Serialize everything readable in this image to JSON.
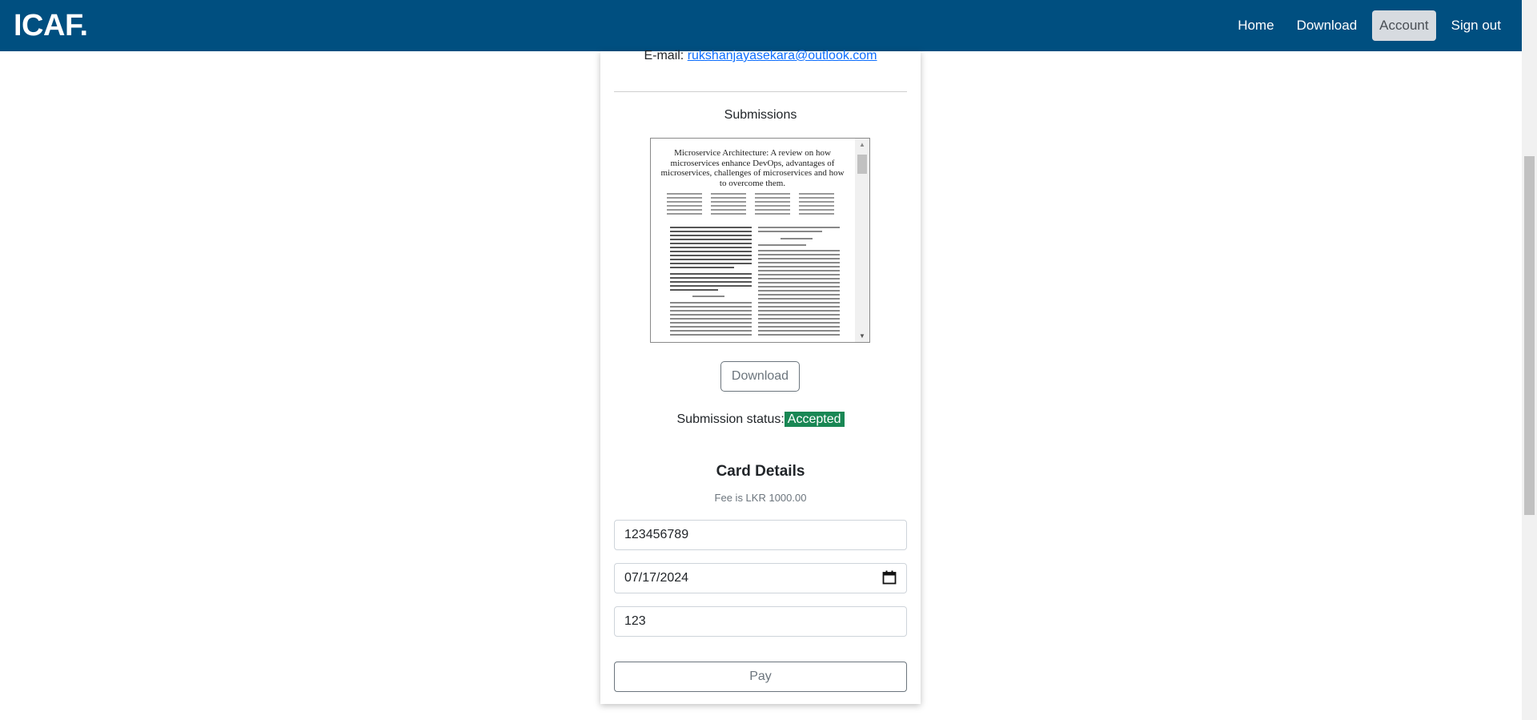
{
  "navbar": {
    "brand": "ICAF.",
    "items": [
      {
        "label": "Home"
      },
      {
        "label": "Download"
      },
      {
        "label": "Account"
      },
      {
        "label": "Sign out"
      }
    ]
  },
  "profile": {
    "email_label": "E-mail:",
    "email": "rukshanjayasekara@outlook.com"
  },
  "submissions": {
    "title": "Submissions",
    "paper_title": "Microservice Architecture: A review on how microservices enhance DevOps, advantages of microservices, challenges of microservices and how to overcome them.",
    "download_label": "Download",
    "status_label": "Submission status:",
    "status_value": "Accepted"
  },
  "card": {
    "title": "Card Details",
    "fee": "Fee is LKR 1000.00",
    "card_number": "123456789",
    "expiry": "07/17/2024",
    "cvv": "123",
    "pay_label": "Pay"
  },
  "colors": {
    "navbar": "#004f80",
    "accepted_badge": "#198754"
  }
}
